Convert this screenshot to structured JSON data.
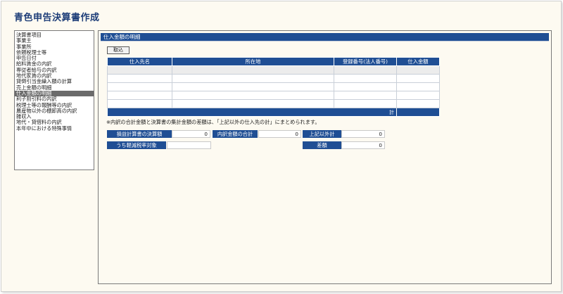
{
  "app": {
    "title": "青色申告決算書作成"
  },
  "sidebar": {
    "items": [
      {
        "label": "決算書項目"
      },
      {
        "label": "事業主"
      },
      {
        "label": "事業所"
      },
      {
        "label": "依頼税理士等"
      },
      {
        "label": "申告日付"
      },
      {
        "label": "給料賃金の内訳"
      },
      {
        "label": "専従者給与の内訳"
      },
      {
        "label": "地代家賃の内訳"
      },
      {
        "label": "貸倒引当金繰入額の計算"
      },
      {
        "label": "売上金額の明細"
      },
      {
        "label": "仕入金額の明細",
        "selected": true
      },
      {
        "label": "利子割引料の内訳"
      },
      {
        "label": "税理士等の報酬等の内訳"
      },
      {
        "label": "農産物以外の棚卸高の内訳"
      },
      {
        "label": "雑収入"
      },
      {
        "label": "地代・貸借料の内訳"
      },
      {
        "label": "本年中における特殊事情"
      }
    ]
  },
  "main": {
    "section_title": "仕入金額の明細",
    "import_button": "取込",
    "table": {
      "headers": [
        "仕入先名",
        "所在地",
        "登録番号(法人番号)",
        "仕入金額"
      ],
      "rows": [
        [
          "",
          "",
          "",
          ""
        ],
        [
          "",
          "",
          "",
          ""
        ],
        [
          "",
          "",
          "",
          ""
        ],
        [
          "",
          "",
          "",
          ""
        ],
        [
          "",
          "",
          "",
          ""
        ]
      ],
      "total_label": "計"
    },
    "note": "※内訳の合計金額と決算書の集計金額の差額は、「上記以外の仕入先の計」にまとめられます。",
    "summary": {
      "settlement_label": "損益計算書の決算額",
      "settlement_value": "0",
      "breakdown_label": "内訳金額の合計",
      "breakdown_value": "0",
      "other_label": "上記以外計",
      "other_value": "0",
      "reduced_tax_label": "うち軽減税率対象",
      "reduced_tax_value": "",
      "diff_label": "差額",
      "diff_value": "0"
    }
  }
}
